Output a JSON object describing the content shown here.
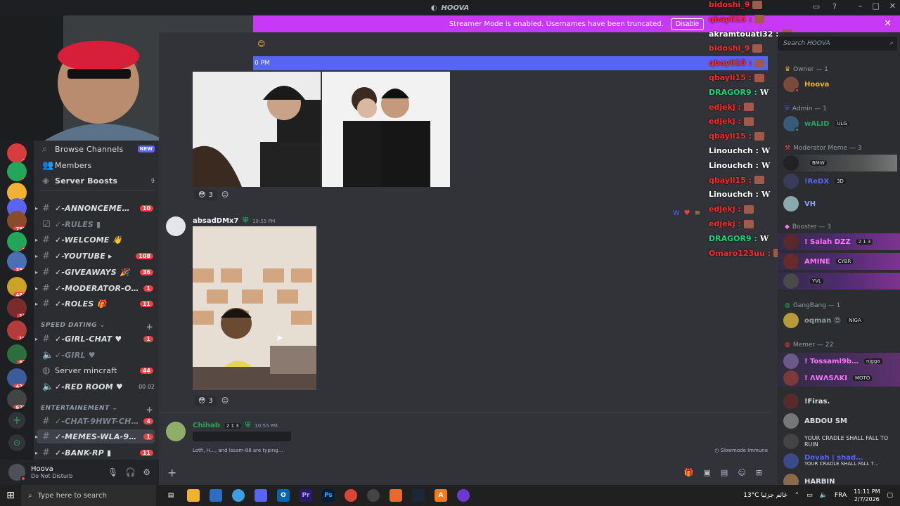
{
  "window": {
    "title": "HOOVA"
  },
  "banner": {
    "text": "Streamer Mode is enabled. Usernames have been truncated.",
    "disable_label": "Disable",
    "close_icon": "close-icon"
  },
  "pinbar": {
    "time": "0 PM"
  },
  "servers": [
    {
      "badge": "2"
    },
    {
      "badge": "2"
    },
    {
      "badge": "1"
    },
    {
      "badge": "1"
    },
    {
      "badge": "793"
    },
    {
      "badge": "1"
    },
    {
      "badge": "393"
    },
    {
      "badge": "481"
    },
    {
      "badge": "10"
    },
    {
      "badge": "1K"
    },
    {
      "badge": "87"
    },
    {
      "badge": "434"
    },
    {
      "badge": "626"
    }
  ],
  "sidebar": {
    "browse": {
      "label": "Browse Channels",
      "badge": "NEW"
    },
    "members": {
      "label": "Members"
    },
    "boosts": {
      "label": "Server Boosts",
      "count": "9"
    },
    "channels": [
      {
        "name": "✓-ANNONCEMENT…",
        "count": "10"
      },
      {
        "name": "✓-RULES ▮",
        "count": ""
      },
      {
        "name": "✓-WELCOME 👋",
        "count": ""
      },
      {
        "name": "✓-YOUTUBE ▸",
        "count": "108"
      },
      {
        "name": "✓-GIVEAWAYS 🎉",
        "count": "36"
      },
      {
        "name": "✓-MODERATOR-ON…",
        "count": "1"
      },
      {
        "name": "✓-ROLES 🎁",
        "count": "11"
      }
    ],
    "cat1": "SPEED DATING",
    "channels2": [
      {
        "name": "✓-GIRL-CHAT ♥",
        "count": "1"
      },
      {
        "name": "✓-GIRL ♥",
        "count": ""
      },
      {
        "name": "Server mincraft",
        "count": "44"
      },
      {
        "name": "✓-RED ROOM ♥",
        "count": "00  02"
      }
    ],
    "cat2": "ENTERTAINEMENT",
    "channels3": [
      {
        "name": "✓-CHAT-9HWT-CHR…",
        "count": "4"
      },
      {
        "name": "✓-MEMES-WLA-9W…",
        "count": "1"
      },
      {
        "name": "✓-BANK-RP ▮",
        "count": "11"
      }
    ]
  },
  "user": {
    "name": "Hoova",
    "status": "Do Not Disturb"
  },
  "messages": {
    "reaction1": "3",
    "author2": "absadDMx7",
    "time2": "10:55 PM",
    "reaction2": "3",
    "author3": "Chihab",
    "badge3": "2 1 3",
    "time3": "10:55 PM",
    "typing": "Lotfi, H…, and Issam-88 are typing…",
    "slowmode": "Slowmode Immune"
  },
  "overlay": [
    {
      "name": "bidoshi_9",
      "color": "#ff2a2a",
      "mark": "em"
    },
    {
      "name": "qbayli15 :",
      "color": "#ff2a2a",
      "mark": "em"
    },
    {
      "name": "akramtouati32 :",
      "color": "#ffffff",
      "mark": "em"
    },
    {
      "name": "bidoshi_9",
      "color": "#ff2a2a",
      "mark": "em"
    },
    {
      "name": "qbayli15 :",
      "color": "#ff2a2a",
      "mark": "em"
    },
    {
      "name": "qbayli15 :",
      "color": "#ff2a2a",
      "mark": "em"
    },
    {
      "name": "DRAGOR9 :",
      "color": "#22d37a",
      "mark": "W"
    },
    {
      "name": "edjekj :",
      "color": "#ff2a2a",
      "mark": "em"
    },
    {
      "name": "edjekj :",
      "color": "#ff2a2a",
      "mark": "em"
    },
    {
      "name": "qbayli15 :",
      "color": "#ff2a2a",
      "mark": "em"
    },
    {
      "name": "Linouchch :",
      "color": "#ffffff",
      "mark": "W"
    },
    {
      "name": "Linouchch :",
      "color": "#ffffff",
      "mark": "W"
    },
    {
      "name": "qbayli15 :",
      "color": "#ff2a2a",
      "mark": "em"
    },
    {
      "name": "Linouchch :",
      "color": "#ffffff",
      "mark": "W"
    },
    {
      "name": "edjekj :",
      "color": "#ff2a2a",
      "mark": "em"
    },
    {
      "name": "edjekj :",
      "color": "#ff2a2a",
      "mark": "em"
    },
    {
      "name": "DRAGOR9 :",
      "color": "#22d37a",
      "mark": "W"
    },
    {
      "name": "Omaro123uu :",
      "color": "#ff2a2a",
      "mark": "em"
    }
  ],
  "members": {
    "search_placeholder": "Search HOOVA",
    "groups": [
      {
        "title": "Owner — 1",
        "items": [
          {
            "name": "Hoova",
            "color": "#f0b232",
            "tag": ""
          }
        ]
      },
      {
        "title": "Admin — 1",
        "items": [
          {
            "name": "wALID",
            "color": "#23a55a",
            "tag": "ULG"
          }
        ]
      },
      {
        "title": "Moderator Meme — 3",
        "items": [
          {
            "name": "",
            "color": "#dbdee1",
            "tag": "BMW"
          },
          {
            "name": "!ReDX",
            "color": "#5865f2",
            "tag": "3D"
          },
          {
            "name": "VH",
            "color": "#949cf7",
            "tag": ""
          }
        ]
      },
      {
        "title": "Booster — 3",
        "items": [
          {
            "name": "! Salah DZZ",
            "color": "#ff73fa",
            "tag": "2 1 3"
          },
          {
            "name": "AMINE",
            "color": "#ff73fa",
            "tag": "CYBR"
          },
          {
            "name": "",
            "color": "#ff73fa",
            "tag": "YVL"
          }
        ]
      },
      {
        "title": "GangBang — 1",
        "items": [
          {
            "name": "oqman 😍",
            "color": "#949ba4",
            "tag": "NIGA"
          }
        ]
      },
      {
        "title": "Memer — 22",
        "items": [
          {
            "name": "! Tossaml9b…",
            "color": "#ff73fa",
            "tag": "njgga"
          },
          {
            "name": "! ΛWΛSΛKI",
            "color": "#ff73fa",
            "tag": "MOTO"
          },
          {
            "name": "!Firas.",
            "color": "#ffffff",
            "tag": ""
          },
          {
            "name": "ABDOU SM",
            "color": "#ffffff",
            "tag": ""
          },
          {
            "name": "YOUR CRADLE SHALL FALL TO RUIN",
            "color": "#ffffff",
            "tag": ""
          },
          {
            "name": "Dovah | shad…",
            "color": "#5865f2",
            "tag": "YOUR CRADLE SHALL FALL T…"
          },
          {
            "name": "HARBIN",
            "color": "#ffffff",
            "tag": ""
          }
        ]
      }
    ]
  },
  "taskbar": {
    "search_placeholder": "Type here to search",
    "weather": "13°C غائم جزئيا",
    "lang": "FRA",
    "time": "11:11 PM",
    "date": "2/7/2026"
  }
}
